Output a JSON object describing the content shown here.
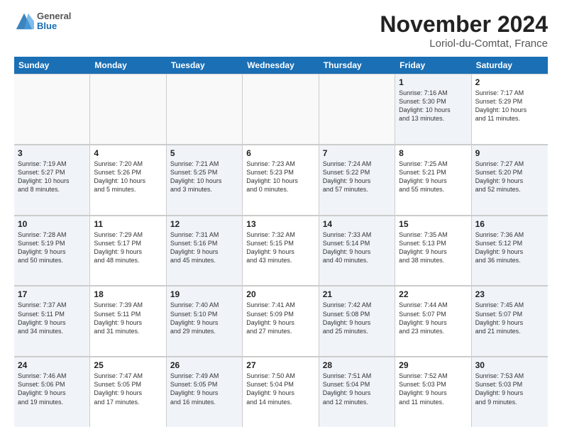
{
  "header": {
    "logo": {
      "general": "General",
      "blue": "Blue"
    },
    "month_year": "November 2024",
    "location": "Loriol-du-Comtat, France"
  },
  "weekdays": [
    "Sunday",
    "Monday",
    "Tuesday",
    "Wednesday",
    "Thursday",
    "Friday",
    "Saturday"
  ],
  "rows": [
    [
      {
        "day": "",
        "info": "",
        "empty": true
      },
      {
        "day": "",
        "info": "",
        "empty": true
      },
      {
        "day": "",
        "info": "",
        "empty": true
      },
      {
        "day": "",
        "info": "",
        "empty": true
      },
      {
        "day": "",
        "info": "",
        "empty": true
      },
      {
        "day": "1",
        "info": "Sunrise: 7:16 AM\nSunset: 5:30 PM\nDaylight: 10 hours\nand 13 minutes.",
        "shaded": true
      },
      {
        "day": "2",
        "info": "Sunrise: 7:17 AM\nSunset: 5:29 PM\nDaylight: 10 hours\nand 11 minutes.",
        "shaded": false
      }
    ],
    [
      {
        "day": "3",
        "info": "Sunrise: 7:19 AM\nSunset: 5:27 PM\nDaylight: 10 hours\nand 8 minutes.",
        "shaded": true
      },
      {
        "day": "4",
        "info": "Sunrise: 7:20 AM\nSunset: 5:26 PM\nDaylight: 10 hours\nand 5 minutes.",
        "shaded": false
      },
      {
        "day": "5",
        "info": "Sunrise: 7:21 AM\nSunset: 5:25 PM\nDaylight: 10 hours\nand 3 minutes.",
        "shaded": true
      },
      {
        "day": "6",
        "info": "Sunrise: 7:23 AM\nSunset: 5:23 PM\nDaylight: 10 hours\nand 0 minutes.",
        "shaded": false
      },
      {
        "day": "7",
        "info": "Sunrise: 7:24 AM\nSunset: 5:22 PM\nDaylight: 9 hours\nand 57 minutes.",
        "shaded": true
      },
      {
        "day": "8",
        "info": "Sunrise: 7:25 AM\nSunset: 5:21 PM\nDaylight: 9 hours\nand 55 minutes.",
        "shaded": false
      },
      {
        "day": "9",
        "info": "Sunrise: 7:27 AM\nSunset: 5:20 PM\nDaylight: 9 hours\nand 52 minutes.",
        "shaded": true
      }
    ],
    [
      {
        "day": "10",
        "info": "Sunrise: 7:28 AM\nSunset: 5:19 PM\nDaylight: 9 hours\nand 50 minutes.",
        "shaded": true
      },
      {
        "day": "11",
        "info": "Sunrise: 7:29 AM\nSunset: 5:17 PM\nDaylight: 9 hours\nand 48 minutes.",
        "shaded": false
      },
      {
        "day": "12",
        "info": "Sunrise: 7:31 AM\nSunset: 5:16 PM\nDaylight: 9 hours\nand 45 minutes.",
        "shaded": true
      },
      {
        "day": "13",
        "info": "Sunrise: 7:32 AM\nSunset: 5:15 PM\nDaylight: 9 hours\nand 43 minutes.",
        "shaded": false
      },
      {
        "day": "14",
        "info": "Sunrise: 7:33 AM\nSunset: 5:14 PM\nDaylight: 9 hours\nand 40 minutes.",
        "shaded": true
      },
      {
        "day": "15",
        "info": "Sunrise: 7:35 AM\nSunset: 5:13 PM\nDaylight: 9 hours\nand 38 minutes.",
        "shaded": false
      },
      {
        "day": "16",
        "info": "Sunrise: 7:36 AM\nSunset: 5:12 PM\nDaylight: 9 hours\nand 36 minutes.",
        "shaded": true
      }
    ],
    [
      {
        "day": "17",
        "info": "Sunrise: 7:37 AM\nSunset: 5:11 PM\nDaylight: 9 hours\nand 34 minutes.",
        "shaded": true
      },
      {
        "day": "18",
        "info": "Sunrise: 7:39 AM\nSunset: 5:11 PM\nDaylight: 9 hours\nand 31 minutes.",
        "shaded": false
      },
      {
        "day": "19",
        "info": "Sunrise: 7:40 AM\nSunset: 5:10 PM\nDaylight: 9 hours\nand 29 minutes.",
        "shaded": true
      },
      {
        "day": "20",
        "info": "Sunrise: 7:41 AM\nSunset: 5:09 PM\nDaylight: 9 hours\nand 27 minutes.",
        "shaded": false
      },
      {
        "day": "21",
        "info": "Sunrise: 7:42 AM\nSunset: 5:08 PM\nDaylight: 9 hours\nand 25 minutes.",
        "shaded": true
      },
      {
        "day": "22",
        "info": "Sunrise: 7:44 AM\nSunset: 5:07 PM\nDaylight: 9 hours\nand 23 minutes.",
        "shaded": false
      },
      {
        "day": "23",
        "info": "Sunrise: 7:45 AM\nSunset: 5:07 PM\nDaylight: 9 hours\nand 21 minutes.",
        "shaded": true
      }
    ],
    [
      {
        "day": "24",
        "info": "Sunrise: 7:46 AM\nSunset: 5:06 PM\nDaylight: 9 hours\nand 19 minutes.",
        "shaded": true
      },
      {
        "day": "25",
        "info": "Sunrise: 7:47 AM\nSunset: 5:05 PM\nDaylight: 9 hours\nand 17 minutes.",
        "shaded": false
      },
      {
        "day": "26",
        "info": "Sunrise: 7:49 AM\nSunset: 5:05 PM\nDaylight: 9 hours\nand 16 minutes.",
        "shaded": true
      },
      {
        "day": "27",
        "info": "Sunrise: 7:50 AM\nSunset: 5:04 PM\nDaylight: 9 hours\nand 14 minutes.",
        "shaded": false
      },
      {
        "day": "28",
        "info": "Sunrise: 7:51 AM\nSunset: 5:04 PM\nDaylight: 9 hours\nand 12 minutes.",
        "shaded": true
      },
      {
        "day": "29",
        "info": "Sunrise: 7:52 AM\nSunset: 5:03 PM\nDaylight: 9 hours\nand 11 minutes.",
        "shaded": false
      },
      {
        "day": "30",
        "info": "Sunrise: 7:53 AM\nSunset: 5:03 PM\nDaylight: 9 hours\nand 9 minutes.",
        "shaded": true
      }
    ]
  ]
}
